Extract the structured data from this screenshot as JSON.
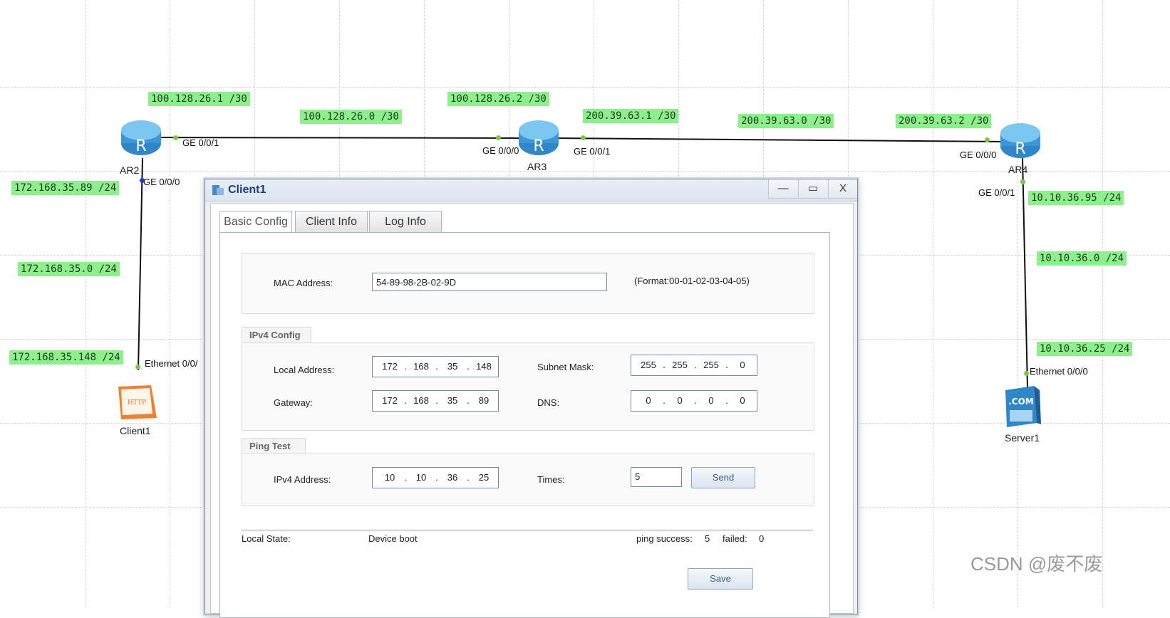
{
  "topology": {
    "devices": {
      "ar2": "AR2",
      "ar3": "AR3",
      "ar4": "AR4",
      "client1": "Client1",
      "server1": "Server1"
    },
    "ports": {
      "ar2_ge001": "GE 0/0/1",
      "ar2_ge000": "GE 0/0/0",
      "ar3_ge000": "GE 0/0/0",
      "ar3_ge001": "GE 0/0/1",
      "ar4_ge000": "GE 0/0/0",
      "ar4_ge001": "GE 0/0/1",
      "client1_eth": "Ethernet 0/0/",
      "server1_eth": "Ethernet 0/0/0"
    },
    "ip_labels": {
      "l1": "100.128.26.1 /30",
      "l2": "100.128.26.0 /30",
      "l3": "100.128.26.2 /30",
      "l4": "200.39.63.1 /30",
      "l5": "200.39.63.0 /30",
      "l6": "200.39.63.2 /30",
      "l7": "172.168.35.89 /24",
      "l8": "172.168.35.0 /24",
      "l9": "172.168.35.148 /24",
      "l10": "10.10.36.95 /24",
      "l11": "10.10.36.0 /24",
      "l12": "10.10.36.25 /24"
    },
    "icons": {
      "client_icon_text": "HTTP",
      "server_icon_text": ".COM",
      "router_letter": "R"
    }
  },
  "dialog": {
    "title": "Client1",
    "window_buttons": {
      "minimize": "—",
      "maximize": "▭",
      "close": "X"
    },
    "tabs": [
      "Basic Config",
      "Client Info",
      "Log Info"
    ],
    "active_tab": "Basic Config",
    "mac": {
      "label": "MAC Address:",
      "value": "54-89-98-2B-02-9D",
      "format_hint": "(Format:00-01-02-03-04-05)"
    },
    "ipv4_config": {
      "header": "IPv4 Config",
      "local_address_label": "Local Address:",
      "local_address": [
        "172",
        "168",
        "35",
        "148"
      ],
      "subnet_mask_label": "Subnet Mask:",
      "subnet_mask": [
        "255",
        "255",
        "255",
        "0"
      ],
      "gateway_label": "Gateway:",
      "gateway": [
        "172",
        "168",
        "35",
        "89"
      ],
      "dns_label": "DNS:",
      "dns": [
        "0",
        "0",
        "0",
        "0"
      ]
    },
    "ping_test": {
      "header": "Ping Test",
      "ipv4_label": "IPv4 Address:",
      "ipv4": [
        "10",
        "10",
        "36",
        "25"
      ],
      "times_label": "Times:",
      "times_value": "5",
      "send_label": "Send"
    },
    "status": {
      "local_state_label": "Local State:",
      "local_state_value": "Device boot",
      "ping_success_label": "ping success:",
      "ping_success_value": "5",
      "failed_label": "failed:",
      "failed_value": "0"
    },
    "save_label": "Save"
  },
  "watermark": "CSDN @废不废",
  "colors": {
    "ip_label_bg": "#8df08d",
    "port_dot": "#7ac943",
    "port_dot_active": "#1a3cd8",
    "router_blue": "#4aa3df",
    "title_text": "#1e3c78"
  }
}
